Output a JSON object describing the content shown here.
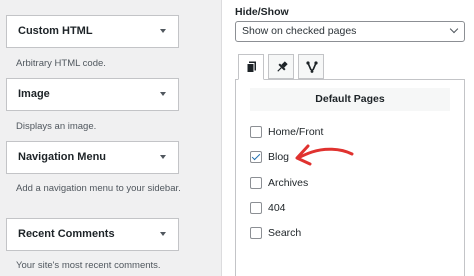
{
  "widgets": [
    {
      "title": "Custom HTML",
      "description": "Arbitrary HTML code."
    },
    {
      "title": "Image",
      "description": "Displays an image."
    },
    {
      "title": "Navigation Menu",
      "description": "Add a navigation menu to your sidebar."
    },
    {
      "title": "Recent Comments",
      "description": "Your site's most recent comments."
    }
  ],
  "visibility": {
    "label": "Hide/Show",
    "select_value": "Show on checked pages",
    "tabs": [
      {
        "icon": "page-icon",
        "active": true
      },
      {
        "icon": "pin-icon",
        "active": false
      },
      {
        "icon": "branch-icon",
        "active": false
      }
    ],
    "panel_title": "Default Pages",
    "options": [
      {
        "label": "Home/Front",
        "checked": false
      },
      {
        "label": "Blog",
        "checked": true
      },
      {
        "label": "Archives",
        "checked": false
      },
      {
        "label": "404",
        "checked": false
      },
      {
        "label": "Search",
        "checked": false
      }
    ]
  },
  "colors": {
    "annotation_arrow": "#e0322f",
    "checkbox_check": "#2271b1"
  }
}
